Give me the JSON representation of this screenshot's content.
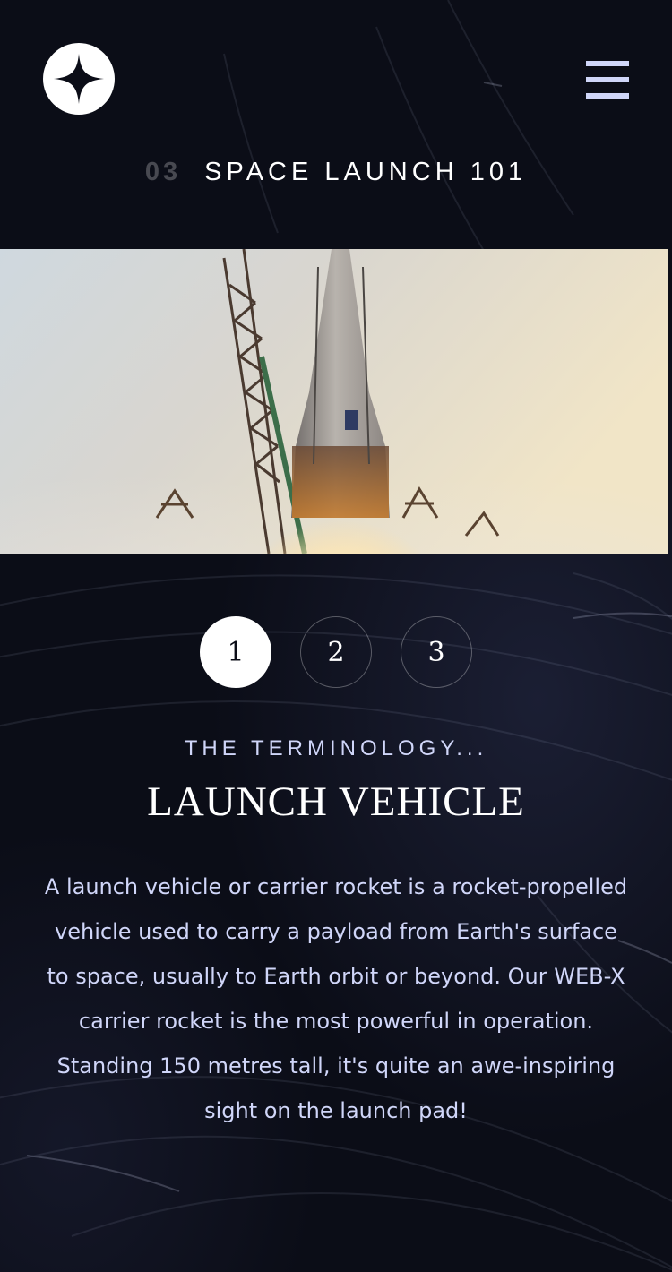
{
  "logo": {
    "icon": "four-point-star-icon"
  },
  "menu": {
    "icon": "hamburger-menu-icon"
  },
  "heading": {
    "number": "03",
    "text": "SPACE LAUNCH 101"
  },
  "image": {
    "subject": "rocket-launch-photo"
  },
  "pager": {
    "items": [
      {
        "label": "1",
        "active": true
      },
      {
        "label": "2",
        "active": false
      },
      {
        "label": "3",
        "active": false
      }
    ]
  },
  "terminology": {
    "subtitle": "THE TERMINOLOGY...",
    "title": "LAUNCH VEHICLE",
    "description": "A launch vehicle or carrier rocket is a rocket-propelled vehicle used to carry a payload from Earth's surface to space, usually to Earth orbit or beyond. Our WEB-X carrier rocket is the most powerful in operation. Standing 150 metres tall, it's quite an awe-inspiring sight on the launch pad!"
  },
  "colors": {
    "background": "#0b0d17",
    "accent": "#d0d6f9",
    "white": "#ffffff"
  }
}
